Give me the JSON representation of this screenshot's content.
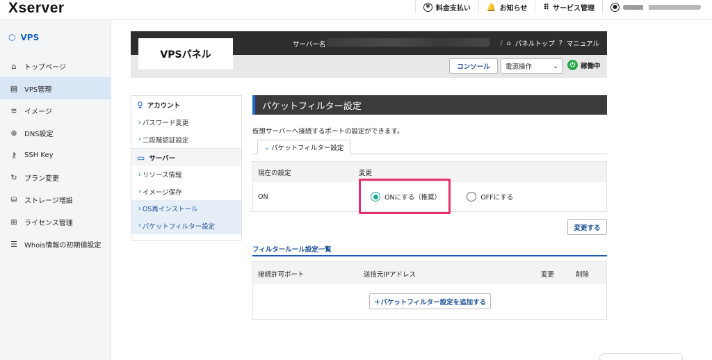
{
  "header": {
    "logo": "Xserver",
    "nav": [
      {
        "icon": "yen-icon",
        "label": "料金支払い"
      },
      {
        "icon": "bell-icon",
        "label": "お知らせ"
      },
      {
        "icon": "grid-icon",
        "label": "サービス管理"
      }
    ]
  },
  "sidebar": {
    "title": "VPS",
    "items": [
      {
        "label": "トップページ",
        "icon": "home-icon"
      },
      {
        "label": "VPS管理",
        "icon": "server-icon",
        "active": true
      },
      {
        "label": "イメージ",
        "icon": "layers-icon"
      },
      {
        "label": "DNS設定",
        "icon": "globe-icon"
      },
      {
        "label": "SSH Key",
        "icon": "key-icon"
      },
      {
        "label": "プラン変更",
        "icon": "refresh-icon"
      },
      {
        "label": "ストレージ増設",
        "icon": "storage-icon"
      },
      {
        "label": "ライセンス管理",
        "icon": "windows-icon"
      },
      {
        "label": "Whois情報の初期値設定",
        "icon": "document-icon"
      }
    ]
  },
  "panel": {
    "title": "VPSパネル",
    "server_label": "サーバー名",
    "link_top": "パネルトップ",
    "link_manual": "マニュアル",
    "console_button": "コンソール",
    "power_select": "電源操作",
    "status": "稼働中"
  },
  "leftnav": {
    "account_heading": "アカウント",
    "account_items": [
      "パスワード変更",
      "二段階認証設定"
    ],
    "server_heading": "サーバー",
    "server_items": [
      "リソース情報",
      "イメージ保存",
      "OS再インストール",
      "パケットフィルター設定"
    ]
  },
  "content": {
    "section_title": "パケットフィルター設定",
    "description": "仮想サーバーへ接続するポートの設定ができます。",
    "tab_label": "パケットフィルター設定",
    "table_head_current": "現在の設定",
    "table_head_change": "変更",
    "current_value": "ON",
    "option_on": "ONにする（推奨）",
    "option_off": "OFFにする",
    "change_button": "変更する"
  },
  "rules": {
    "title": "フィルタールール設定一覧",
    "columns": [
      "接続許可ポート",
      "送信元IPアドレス",
      "変更",
      "削除"
    ],
    "add_button": "＋パケットフィルター設定を追加する"
  }
}
